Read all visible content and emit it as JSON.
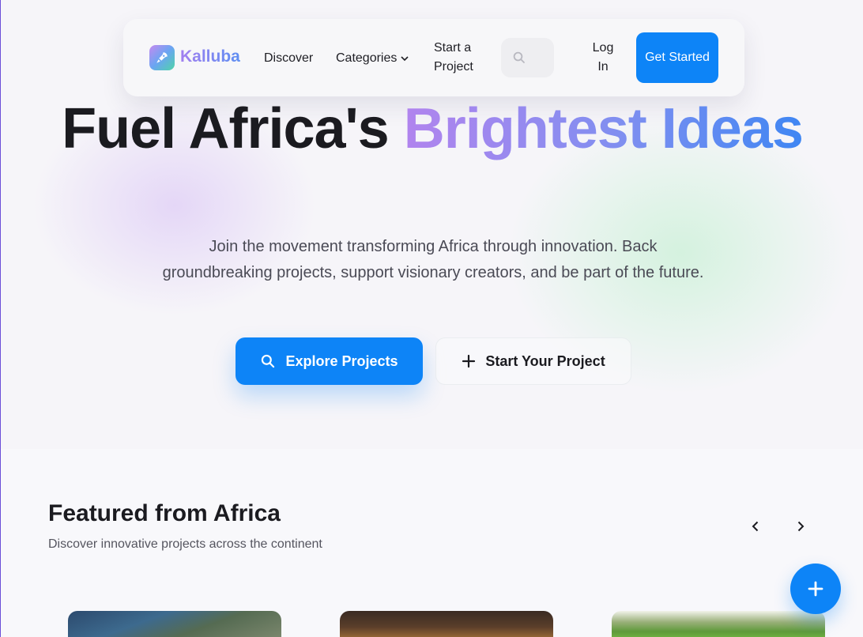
{
  "nav": {
    "brand": "Kalluba",
    "links": {
      "discover": "Discover",
      "categories": "Categories",
      "start_project": "Start a Project",
      "login": "Log In"
    },
    "get_started": "Get Started"
  },
  "hero": {
    "headline_plain": "Fuel Africa's",
    "headline_highlight": "Brightest Ideas",
    "subtitle": "Join the movement transforming Africa through innovation. Back groundbreaking projects, support visionary creators, and be part of the future.",
    "explore_button": "Explore Projects",
    "start_button": "Start Your Project"
  },
  "featured": {
    "title": "Featured from Africa",
    "subtitle": "Discover innovative projects across the continent"
  },
  "icons": {
    "logo": "rocket-icon",
    "categories_caret": "chevron-down-icon",
    "search": "search-icon",
    "explore": "search-icon",
    "start": "plus-icon",
    "prev": "chevron-left-icon",
    "next": "chevron-right-icon",
    "fab": "plus-icon"
  },
  "colors": {
    "accent": "#0d84f7",
    "gradient_start": "#b184ee",
    "gradient_end": "#3f86f3"
  }
}
